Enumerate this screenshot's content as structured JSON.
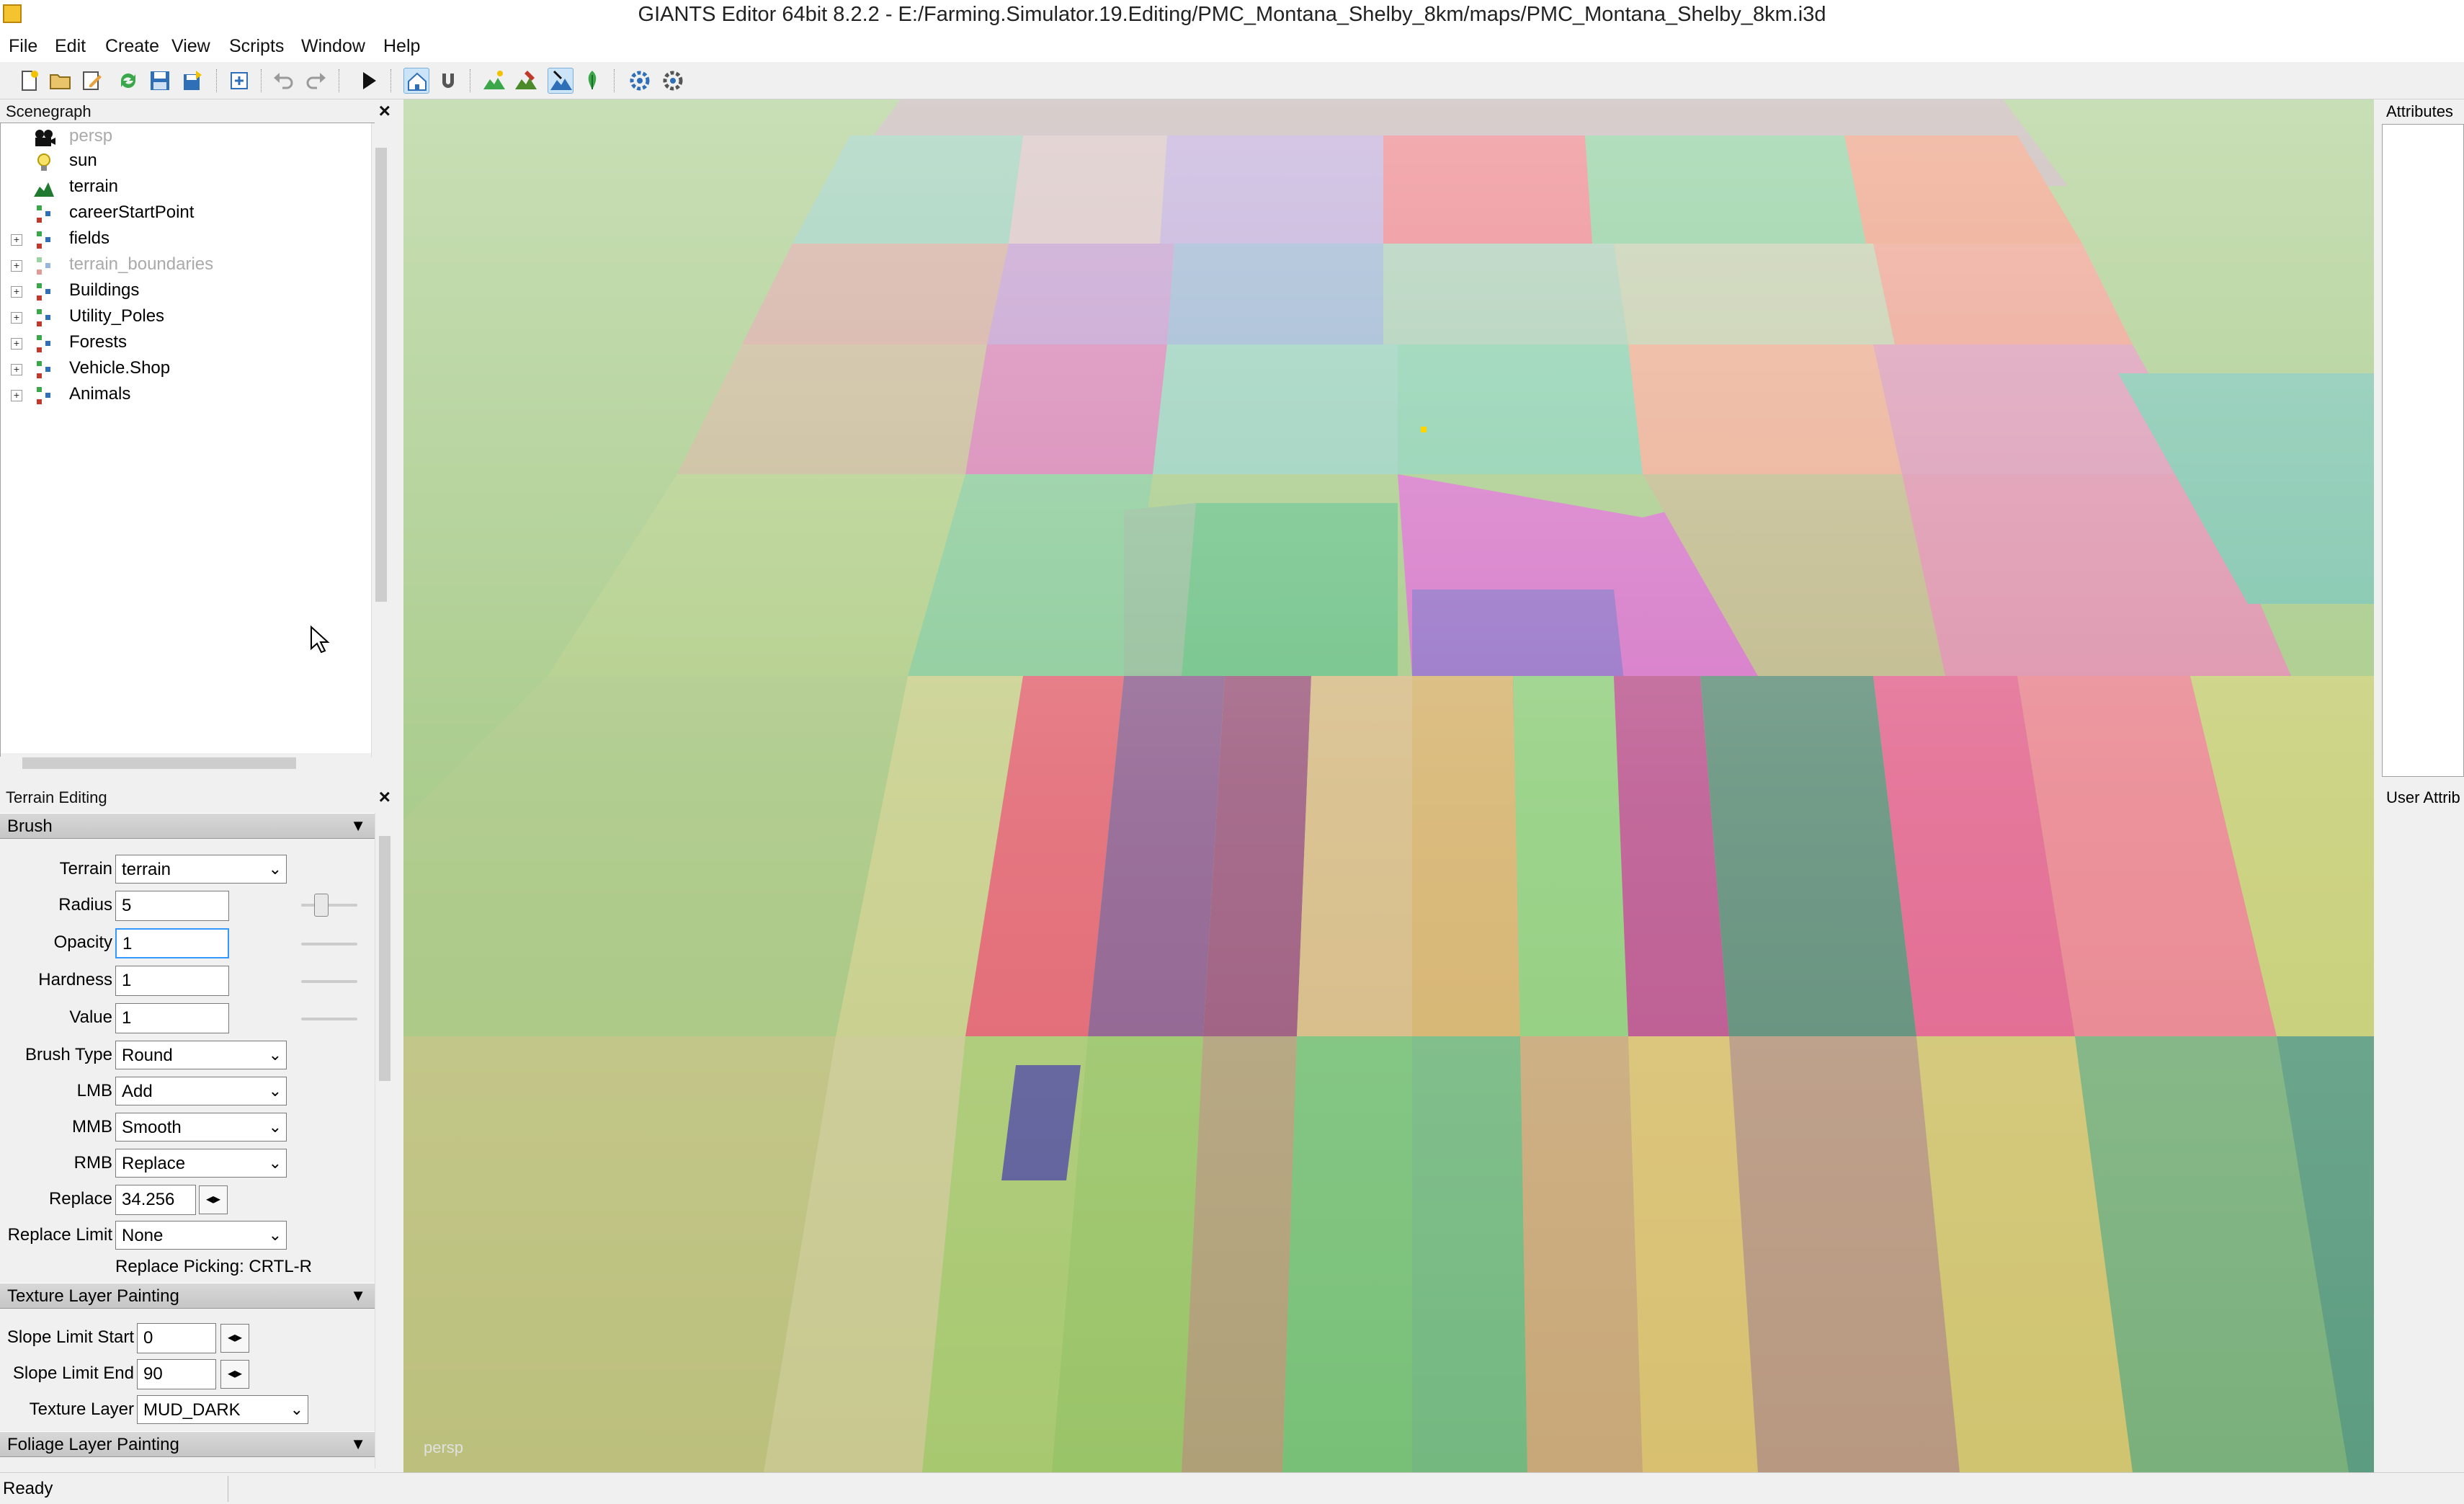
{
  "window": {
    "title": "GIANTS Editor 64bit 8.2.2 - E:/Farming.Simulator.19.Editing/PMC_Montana_Shelby_8km/maps/PMC_Montana_Shelby_8km.i3d"
  },
  "menu": {
    "items": [
      "File",
      "Edit",
      "Create",
      "View",
      "Scripts",
      "Window",
      "Help"
    ]
  },
  "toolbar": {
    "icons": [
      "new-file-icon",
      "open-icon",
      "edit-icon",
      "refresh-icon",
      "save-icon",
      "save-as-icon",
      "export-icon",
      "undo-icon",
      "redo-icon",
      "play-icon",
      "home-select-icon",
      "magnet-icon",
      "terrain-sculpt-icon",
      "terrain-paint-icon",
      "terrain-select-icon",
      "foliage-paint-icon",
      "settings-gear-icon",
      "settings-gear2-icon"
    ]
  },
  "scenegraph": {
    "title": "Scenegraph",
    "close": "×",
    "nodes": [
      {
        "label": "persp",
        "icon": "camera-icon"
      },
      {
        "label": "sun",
        "icon": "light-bulb-icon"
      },
      {
        "label": "terrain",
        "icon": "terrain-icon"
      },
      {
        "label": "careerStartPoint",
        "icon": "transform-group-icon"
      },
      {
        "label": "fields",
        "icon": "transform-group-icon"
      },
      {
        "label": "terrain_boundaries",
        "icon": "transform-group-icon"
      },
      {
        "label": "Buildings",
        "icon": "transform-group-icon"
      },
      {
        "label": "Utility_Poles",
        "icon": "transform-group-icon"
      },
      {
        "label": "Forests",
        "icon": "transform-group-icon"
      },
      {
        "label": "Vehicle.Shop",
        "icon": "transform-group-icon"
      },
      {
        "label": "Animals",
        "icon": "transform-group-icon"
      }
    ]
  },
  "terrain_editing": {
    "title": "Terrain Editing",
    "close": "×",
    "brush": {
      "section": "Brush",
      "terrain_label": "Terrain",
      "terrain_value": "terrain",
      "radius_label": "Radius",
      "radius_value": "5",
      "opacity_label": "Opacity",
      "opacity_value": "1",
      "hardness_label": "Hardness",
      "hardness_value": "1",
      "value_label": "Value",
      "value_value": "1",
      "brush_type_label": "Brush Type",
      "brush_type_value": "Round",
      "lmb_label": "LMB",
      "lmb_value": "Add",
      "mmb_label": "MMB",
      "mmb_value": "Smooth",
      "rmb_label": "RMB",
      "rmb_value": "Replace",
      "replace_label": "Replace",
      "replace_value": "34.256",
      "replace_limit_label": "Replace Limit",
      "replace_limit_value": "None",
      "replace_picking": "Replace Picking: CRTL-R"
    },
    "texture": {
      "section": "Texture Layer Painting",
      "slope_start_label": "Slope Limit Start",
      "slope_start_value": "0",
      "slope_end_label": "Slope Limit End",
      "slope_end_value": "90",
      "texture_layer_label": "Texture Layer",
      "texture_layer_value": "MUD_DARK"
    },
    "foliage": {
      "section": "Foliage Layer Painting"
    }
  },
  "viewport": {
    "camera_label": "persp"
  },
  "attributes": {
    "title": "Attributes"
  },
  "user_attributes": {
    "title": "User Attrib"
  },
  "status": {
    "text": "Ready"
  }
}
